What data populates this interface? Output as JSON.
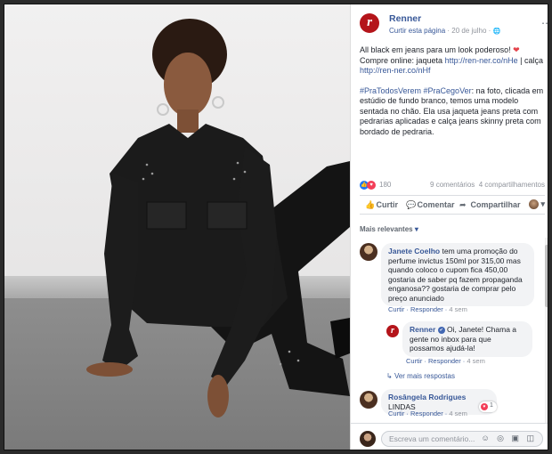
{
  "post": {
    "page_name": "Renner",
    "logo_letter": "r",
    "follow": "Curtir esta página",
    "meta_sep": " · ",
    "date": "20 de julho",
    "globe": "🌐",
    "more": "⋯",
    "text_1": "All black em jeans para um look poderoso!",
    "heart": "❤",
    "text_2": "Compre online: jaqueta",
    "link_1": "http://ren-ner.co/nHe",
    "text_3": " | calça",
    "link_2": "http://ren-ner.co/nHf",
    "hashtags": "#PraTodosVerem #PraCegoVer",
    "description": ": na foto, clicada em estúdio de fundo branco, temos uma modelo sentada no chão. Ela usa jaqueta jeans preta com pedrarias aplicadas e calça jeans skinny preta com bordado de pedraria."
  },
  "stats": {
    "like_icon": "👍",
    "love_icon": "♥",
    "reactions": "180",
    "comments": "9 comentários",
    "shares": "4 compartilhamentos"
  },
  "actions": {
    "like": "Curtir",
    "like_icon": "👍",
    "comment": "Comentar",
    "comment_icon": "💬",
    "share": "Compartilhar",
    "share_icon": "➦",
    "chevron": "▾"
  },
  "comments_filter": {
    "label": "Mais relevantes",
    "caret": "▾"
  },
  "comments": [
    {
      "author": "Janete Coelho",
      "text": "tem uma promoção do perfume invictus 150ml por 315,00 mas quando coloco o cupom fica 450,00 gostaria de saber pq fazem propaganda enganosa?? gostaria de comprar pelo preço anunciado",
      "like": "Curtir",
      "reply": "Responder",
      "time": "4 sem"
    },
    {
      "author": "Renner",
      "verified": "✔",
      "text": "Oi, Janete! Chama a gente no inbox para que possamos ajudá-la!",
      "like": "Curtir",
      "reply": "Responder",
      "time": "4 sem"
    },
    {
      "author": "Rosângela Rodrigues",
      "text": "LINDAS",
      "like": "Curtir",
      "reply": "Responder",
      "time": "4 sem",
      "love_count": "1",
      "love_icon": "♥"
    }
  ],
  "more_replies": {
    "arrow": "↳",
    "label": "Ver mais respostas"
  },
  "composer": {
    "placeholder": "Escreva um comentário...",
    "icons": "☺ ◎ ▣ ◫"
  }
}
